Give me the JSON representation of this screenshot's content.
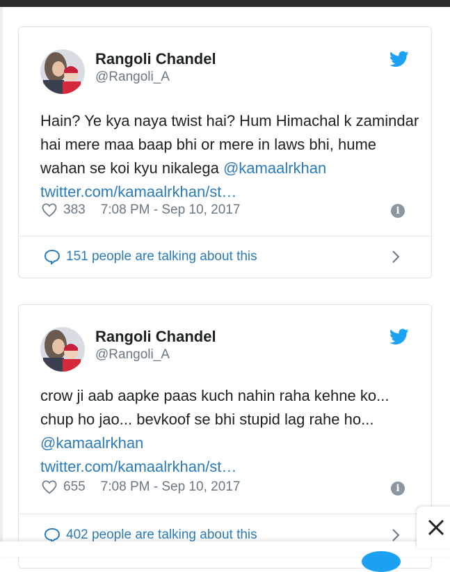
{
  "tweets": [
    {
      "author_name": "Rangoli Chandel",
      "author_handle": "@Rangoli_A",
      "text_plain": "Hain? Ye kya naya twist hai? Hum Himachal k zamindar hai mere maa baap bhi or mere in laws bhi, hume wahan se koi kyu nikalega",
      "text_link": "@kamaalrkhan twitter.com/kamaalrkhan/st…",
      "likes": "383",
      "timestamp": "7:08 PM - Sep 10, 2017",
      "talking": "151 people are talking about this"
    },
    {
      "author_name": "Rangoli Chandel",
      "author_handle": "@Rangoli_A",
      "text_plain": "crow ji aab aapke paas kuch nahin raha kehne ko... chup ho jao... bevkoof se bhi stupid lag rahe ho...",
      "text_mention": "@kamaalrkhan",
      "text_url": "twitter.com/kamaalrkhan/st…",
      "likes": "655",
      "timestamp": "7:08 PM - Sep 10, 2017",
      "talking": "402 people are talking about this"
    }
  ],
  "icons": {
    "platform": "twitter-bird-icon",
    "like": "heart-icon",
    "info": "info-icon",
    "reply": "speech-bubble-icon",
    "more": "chevron-right-icon",
    "close": "close-icon"
  },
  "colors": {
    "link": "#2b7bb9",
    "twitter_blue": "#1da1f2",
    "text": "#1c2022",
    "muted": "#697882"
  }
}
